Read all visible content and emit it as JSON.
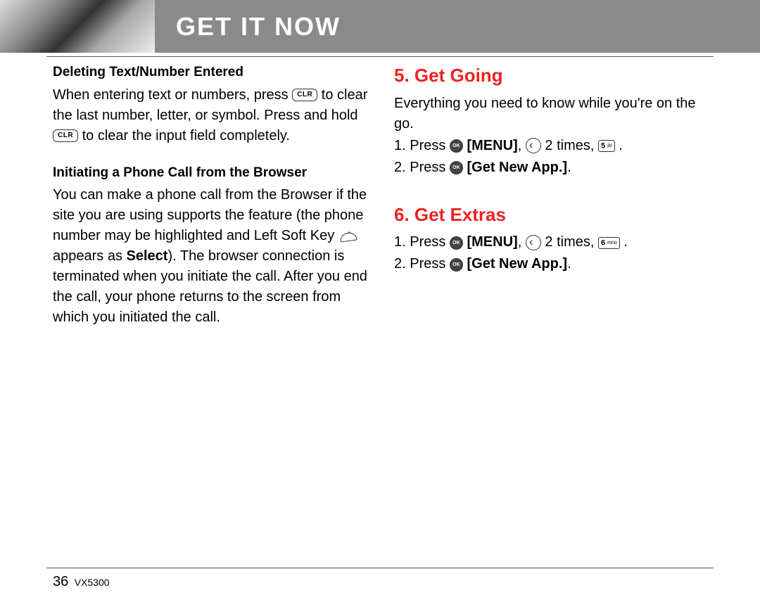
{
  "header": {
    "title": "GET IT NOW"
  },
  "left": {
    "section1": {
      "heading": "Deleting Text/Number Entered",
      "para_part1": "When entering text or numbers, press ",
      "para_part2": " to clear the last number, letter, or symbol. Press and hold ",
      "para_part3": " to clear the input field completely."
    },
    "section2": {
      "heading": "Initiating a Phone Call from the Browser",
      "para_part1": "You can make a phone call from the Browser if the site you are using supports the feature (the phone number may be highlighted and Left Soft Key ",
      "para_part2": " appears as ",
      "select_word": "Select",
      "para_part3": "). The browser connection is terminated when you initiate the call. After you end the call, your phone returns to the screen from which you initiated the call."
    }
  },
  "right": {
    "section1": {
      "heading": "5. Get Going",
      "intro": "Everything you need to know while you're on the go.",
      "step1_prefix": "1.  Press ",
      "menu_label": "[MENU]",
      "step1_mid": ", ",
      "step1_times": " 2 times, ",
      "step1_end": " .",
      "step2_prefix": "2.  Press ",
      "getnewapp": "[Get New App.]",
      "step2_end": "."
    },
    "section2": {
      "heading": "6. Get Extras",
      "step1_prefix": "1.  Press ",
      "menu_label": "[MENU]",
      "step1_mid": ", ",
      "step1_times": " 2 times, ",
      "step1_end": " .",
      "step2_prefix": "2.  Press ",
      "getnewapp": "[Get New App.]",
      "step2_end": "."
    }
  },
  "keys": {
    "clr": "CLR",
    "ok": "OK",
    "num5": "5",
    "num5sub": "jkl",
    "num6": "6",
    "num6sub": "mno"
  },
  "footer": {
    "page": "36",
    "model": "VX5300"
  }
}
